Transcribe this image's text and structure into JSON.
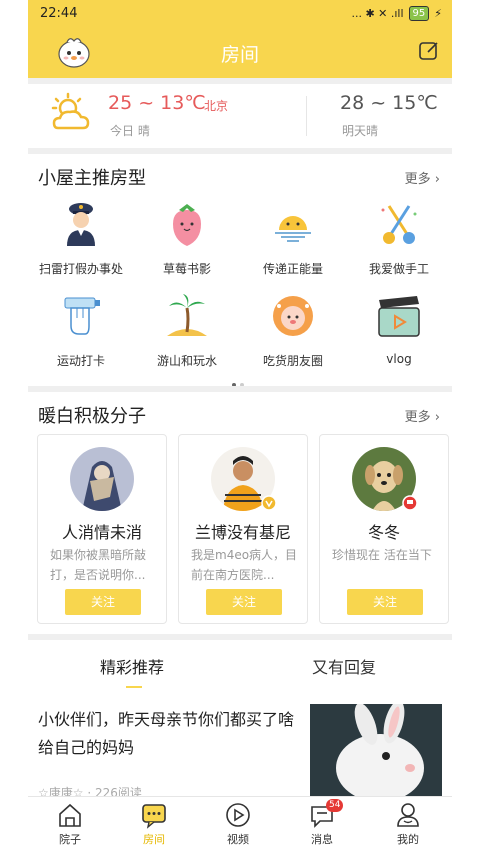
{
  "status": {
    "time": "22:44",
    "icons": "... ✱ ✕ .ıll",
    "battery": "95"
  },
  "header": {
    "title": "房间"
  },
  "weather": {
    "today_range": "25 ~ 13℃",
    "city": "北京",
    "today_label": "今日 晴",
    "tomorrow_range": "28 ~ 15℃",
    "tomorrow_label": "明天晴"
  },
  "rooms": {
    "title": "小屋主推房型",
    "more": "更多",
    "items": [
      {
        "label": "扫雷打假办事处",
        "icon": "police-icon"
      },
      {
        "label": "草莓书影",
        "icon": "strawberry-icon"
      },
      {
        "label": "传递正能量",
        "icon": "sunrise-icon"
      },
      {
        "label": "我爱做手工",
        "icon": "scissors-icon"
      },
      {
        "label": "运动打卡",
        "icon": "fist-bottle-icon"
      },
      {
        "label": "游山和玩水",
        "icon": "palm-tree-icon"
      },
      {
        "label": "吃货朋友圈",
        "icon": "donut-icon"
      },
      {
        "label": "vlog",
        "icon": "clapperboard-icon"
      }
    ]
  },
  "members": {
    "title": "暖白积极分子",
    "more": "更多",
    "follow": "关注",
    "cards": [
      {
        "name": "人消情未消",
        "desc": "如果你被黑暗所敲打，是否说明你..."
      },
      {
        "name": "兰博没有基尼",
        "desc": "我是m4eo病人，目前在南方医院..."
      },
      {
        "name": "冬冬",
        "desc": "珍惜现在 活在当下"
      }
    ]
  },
  "tabs": {
    "active": "精彩推荐",
    "other": "又有回复"
  },
  "article": {
    "title": "小伙伴们，昨天母亲节你们都买了啥给自己的妈妈",
    "meta": "☆康康☆ · 226阅读"
  },
  "nav": {
    "items": [
      {
        "label": "院子"
      },
      {
        "label": "房间"
      },
      {
        "label": "视频"
      },
      {
        "label": "消息",
        "badge": "54"
      },
      {
        "label": "我的"
      }
    ]
  },
  "colors": {
    "accent": "#f8d64e",
    "temp": "#e65a5a",
    "badge": "#e53935"
  }
}
